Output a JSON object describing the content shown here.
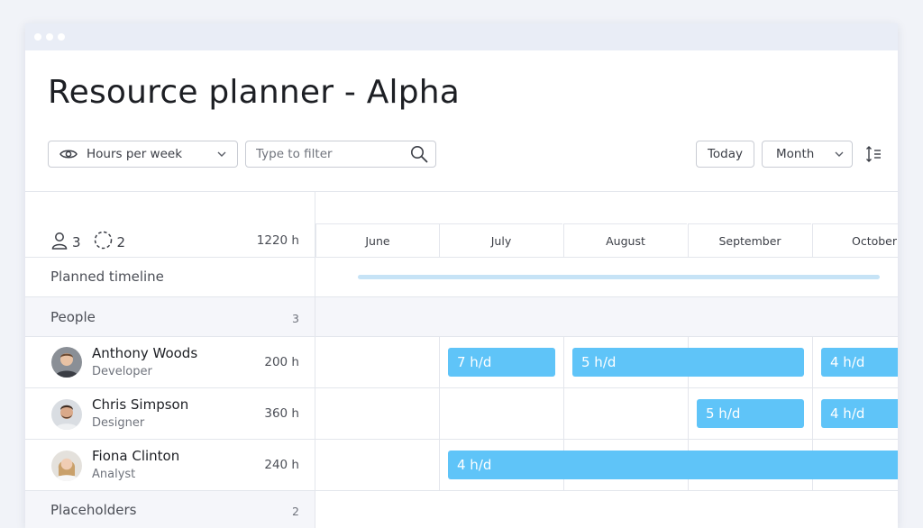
{
  "page": {
    "title": "Resource planner - Alpha"
  },
  "toolbar": {
    "view_label": "Hours per week",
    "filter_placeholder": "Type to filter",
    "today_label": "Today",
    "period_label": "Month"
  },
  "summary": {
    "people_count": "3",
    "placeholder_count": "2",
    "total_hours": "1220 h"
  },
  "months": [
    "June",
    "July",
    "August",
    "September",
    "October"
  ],
  "planned_timeline": {
    "label": "Planned timeline"
  },
  "people_group": {
    "label": "People",
    "count": "3"
  },
  "people": [
    {
      "name": "Anthony Woods",
      "role": "Developer",
      "hours": "200 h"
    },
    {
      "name": "Chris Simpson",
      "role": "Designer",
      "hours": "360 h"
    },
    {
      "name": "Fiona Clinton",
      "role": "Analyst",
      "hours": "240 h"
    }
  ],
  "allocations": {
    "anthony": [
      "7 h/d",
      "5 h/d",
      "4 h/d"
    ],
    "chris": [
      "5 h/d",
      "4 h/d"
    ],
    "fiona": [
      "4 h/d"
    ]
  },
  "placeholders_group": {
    "label": "Placeholders",
    "count": "2"
  },
  "colors": {
    "allocation_bar": "#5fc4f8",
    "timeline_bar": "#c6e3f6",
    "group_background": "#f5f6fa"
  }
}
